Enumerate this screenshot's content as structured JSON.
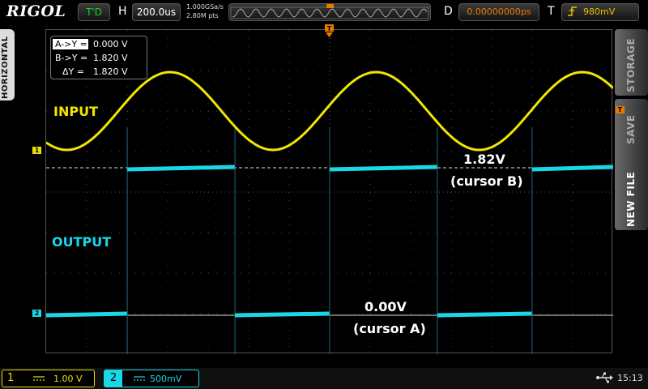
{
  "header": {
    "brand": "RIGOL",
    "run_status": "T'D",
    "horizontal_label": "H",
    "timebase": "200.0us",
    "sample_rate": "1.000GSa/s",
    "memory_depth": "2.80M pts",
    "delay_label": "D",
    "delay_value": "0.00000000ps",
    "trigger_label": "T",
    "trigger_level": "980mV"
  },
  "side_left": {
    "label": "HORIZONTAL"
  },
  "side_menu": {
    "items": [
      {
        "label": "STORAGE"
      },
      {
        "label": "SAVE"
      },
      {
        "label": "NEW FILE"
      }
    ]
  },
  "markers": {
    "ch1": "1",
    "ch2": "2",
    "trigger": "T"
  },
  "cursor_box": {
    "ax_key": "A->Y =",
    "ax_val": "0.000 V",
    "bx_key": "B->Y =",
    "bx_val": "1.820 V",
    "dy_key": "ΔY =",
    "dy_val": "1.820 V"
  },
  "annotations": {
    "input": "INPUT",
    "output": "OUTPUT",
    "cursor_b_value": "1.82V",
    "cursor_b_name": "(cursor B)",
    "cursor_a_value": "0.00V",
    "cursor_a_name": "(cursor A)"
  },
  "channels": {
    "ch1": {
      "number": "1",
      "coupling": "DC",
      "scale": "1.00 V",
      "color": "#e8e000"
    },
    "ch2": {
      "number": "2",
      "coupling": "DC",
      "scale": "500mV",
      "color": "#18d8e8"
    }
  },
  "status": {
    "clock": "15:13"
  },
  "waveforms": {
    "input_sine": {
      "periods_on_screen": 2.75,
      "color": "#f0e600"
    },
    "output_square": {
      "edges_fraction": [
        0.143,
        0.333,
        0.5,
        0.69,
        0.857
      ],
      "color": "#18d8e8"
    }
  }
}
